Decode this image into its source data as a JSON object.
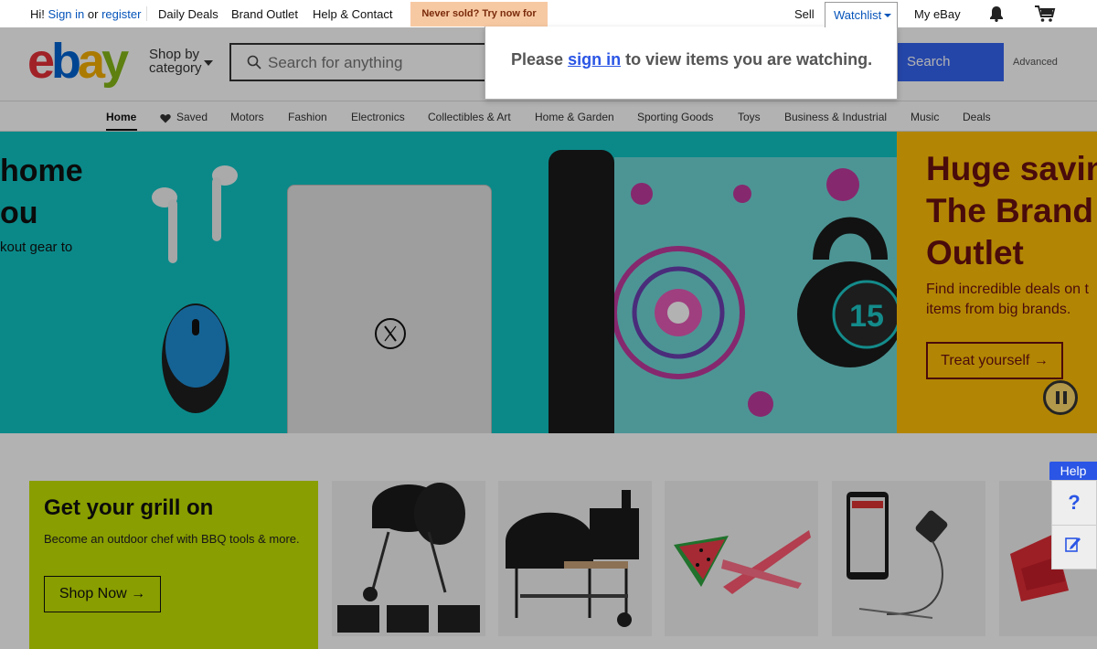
{
  "topbar": {
    "greeting": "Hi!",
    "sign_in": "Sign in",
    "or": "or",
    "register": "register",
    "daily_deals": "Daily Deals",
    "brand_outlet": "Brand Outlet",
    "help_contact": "Help & Contact",
    "promo": "Never sold? Try now for free!",
    "sell": "Sell",
    "watchlist": "Watchlist",
    "my_ebay": "My eBay",
    "icons": [
      "bell-icon",
      "cart-icon"
    ]
  },
  "header": {
    "logo": [
      "e",
      "b",
      "a",
      "y"
    ],
    "shop_by_line1": "Shop by",
    "shop_by_line2": "category",
    "search_placeholder": "Search for anything",
    "search_button": "Search",
    "advanced": "Advanced",
    "logo_colors": [
      "#e53238",
      "#0064d2",
      "#f5af02",
      "#86b817"
    ],
    "accent": "#3665f3"
  },
  "nav": {
    "items": [
      "Home",
      "Saved",
      "Motors",
      "Fashion",
      "Electronics",
      "Collectibles & Art",
      "Home & Garden",
      "Sporting Goods",
      "Toys",
      "Business & Industrial",
      "Music",
      "Deals"
    ],
    "active": "Home"
  },
  "hero": {
    "title_line1": "home",
    "title_line2": "ou",
    "subtitle": "kout gear to",
    "product_badge": "15",
    "right_title_line1": "Huge savin",
    "right_title_line2": "The Brand",
    "right_title_line3": "Outlet",
    "right_text_line1": "Find incredible deals on t",
    "right_text_line2": "items from big brands.",
    "right_button": "Treat yourself"
  },
  "promo_card": {
    "title": "Get your grill on",
    "text": "Become an outdoor chef with BBQ tools & more.",
    "button": "Shop Now"
  },
  "watchlist_popup": {
    "prefix": "Please",
    "link": "sign in",
    "suffix": "to view items you are watching."
  },
  "help_widget": {
    "label": "Help",
    "question": "?"
  }
}
